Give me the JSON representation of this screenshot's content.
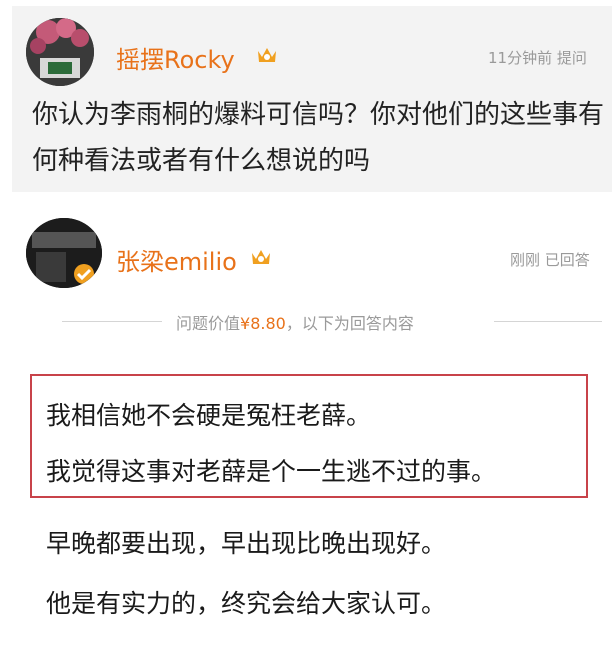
{
  "question": {
    "user_name": "摇摆Rocky",
    "meta": "11分钟前 提问",
    "text": "你认为李雨桐的爆料可信吗？你对他们的这些事有何种看法或者有什么想说的吗"
  },
  "answer": {
    "user_name": "张梁emilio",
    "meta": "刚刚 已回答",
    "divider_prefix": "问题价值",
    "price": "¥8.80",
    "divider_suffix": "，以下为回答内容",
    "highlighted_lines": [
      "我相信她不会硬是冤枉老薛。",
      "我觉得这事对老薛是个一生逃不过的事。"
    ],
    "lines": [
      "早晚都要出现，早出现比晚出现好。",
      "他是有实力的，终究会给大家认可。"
    ]
  },
  "colors": {
    "accent": "#e8721a",
    "highlight_border": "#c8434a",
    "question_bg": "#f3f3f3"
  }
}
